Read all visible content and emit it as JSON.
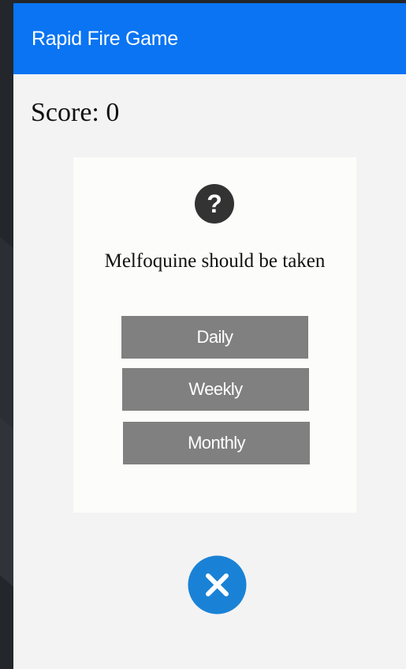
{
  "header": {
    "title": "Rapid Fire Game",
    "color": "#0a74f2"
  },
  "score": {
    "text": "Score: 0"
  },
  "question_card": {
    "icon": "question-circle-icon",
    "question": "Melfoquine should be taken",
    "options": [
      {
        "label": "Daily"
      },
      {
        "label": "Weekly"
      },
      {
        "label": "Monthly"
      }
    ],
    "option_color": "#808080"
  },
  "close_button": {
    "icon": "close-icon",
    "color": "#1a82d6"
  }
}
